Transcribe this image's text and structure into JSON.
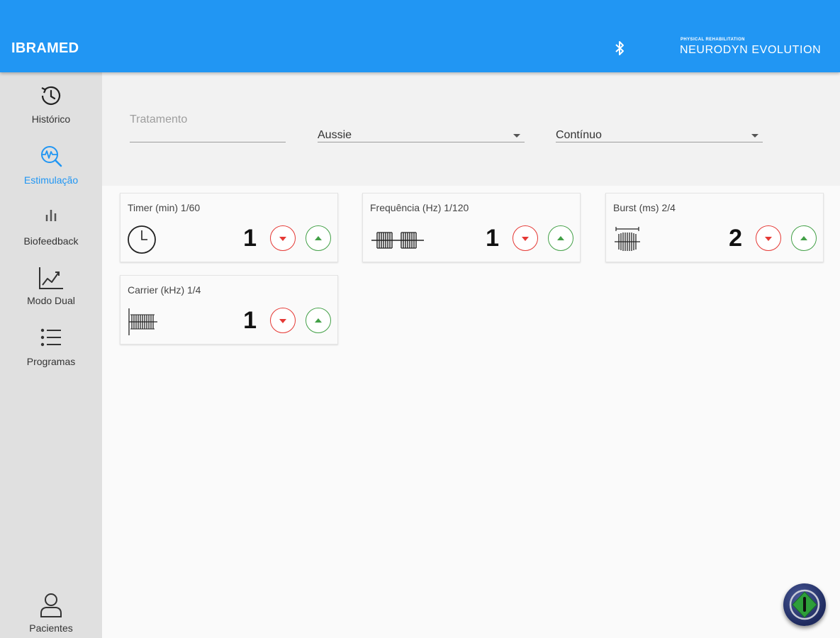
{
  "header": {
    "app_title": "IBRAMED",
    "brand_tagline": "PHYSICAL REHABILITATION",
    "brand_name": "NEURODYN EVOLUTION",
    "bluetooth_icon": "bluetooth-icon",
    "color": "#2196f3"
  },
  "sidebar": {
    "items": [
      {
        "label": "Histórico",
        "icon": "history-icon",
        "active": false
      },
      {
        "label": "Estimulação",
        "icon": "stimulation-icon",
        "active": true
      },
      {
        "label": "Biofeedback",
        "icon": "bar-chart-icon",
        "active": false
      },
      {
        "label": "Modo Dual",
        "icon": "line-chart-icon",
        "active": false
      },
      {
        "label": "Programas",
        "icon": "list-icon",
        "active": false
      },
      {
        "label": "Pacientes",
        "icon": "person-icon",
        "active": false
      }
    ],
    "active_color": "#2196f3"
  },
  "filters": {
    "treatment_placeholder": "Tratamento",
    "treatment_value": "",
    "mode_value": "Aussie",
    "type_value": "Contínuo"
  },
  "cards": [
    {
      "title": "Timer (min) 1/60",
      "value": "1",
      "icon": "clock-icon"
    },
    {
      "title": "Frequência (Hz) 1/120",
      "value": "1",
      "icon": "burst-wave-icon"
    },
    {
      "title": "Burst (ms) 2/4",
      "value": "2",
      "icon": "burst-width-icon"
    },
    {
      "title": "Carrier (kHz) 1/4",
      "value": "1",
      "icon": "carrier-wave-icon"
    }
  ],
  "fab": {
    "icon": "power-start-icon"
  }
}
